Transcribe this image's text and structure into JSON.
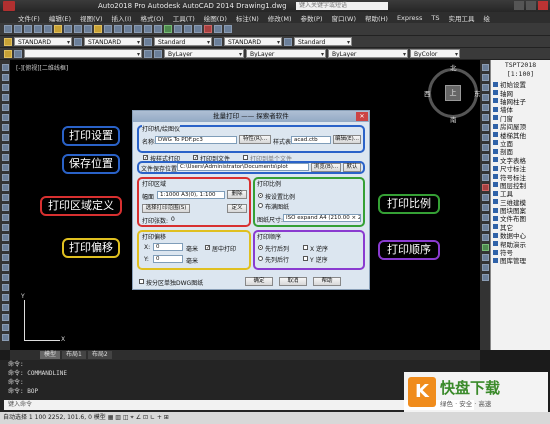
{
  "window": {
    "title": "Auto2018 Pro Autodesk AutoCAD 2014    Drawing1.dwg",
    "search_placeholder": "键入关键字或短语"
  },
  "menu": [
    "文件(F)",
    "编辑(E)",
    "视图(V)",
    "插入(I)",
    "格式(O)",
    "工具(T)",
    "绘图(D)",
    "标注(N)",
    "修改(M)",
    "参数(P)",
    "窗口(W)",
    "帮助(H)",
    "Express",
    "TS",
    "实用工具",
    "绘"
  ],
  "toolbar": {
    "text_style": "STANDARD",
    "dim_style": "STANDARD",
    "style_a": "Standard",
    "style_b": "STANDARD",
    "style_c": "Standard",
    "layer": "ByLayer",
    "linetype": "ByLayer",
    "lineweight": "ByLayer",
    "plot_style": "ByColor"
  },
  "viewport_label": "[-][俯视][二维线框]",
  "viewcube": {
    "north": "北",
    "south": "南",
    "east": "东",
    "west": "西",
    "top": "上"
  },
  "ucs": {
    "x": "X",
    "y": "Y"
  },
  "palette": {
    "header_1": "TSPT2018",
    "header_2": "[1:100]",
    "items": [
      "初始设置",
      "轴网",
      "轴网柱子",
      "墙体",
      "门窗",
      "房间屋顶",
      "楼梯其他",
      "立面",
      "剖面",
      "文字表格",
      "尺寸标注",
      "符号标注",
      "图层控制",
      "工具",
      "三维建模",
      "图块图案",
      "文件布图",
      "其它",
      "数据中心",
      "帮助演示",
      "符号",
      "图库管理"
    ]
  },
  "tabs": [
    "模型",
    "布局1",
    "布局2"
  ],
  "command": {
    "lines": [
      "命令:",
      "命令: COMMANDLINE",
      "命令:",
      "命令: BOP"
    ],
    "input_placeholder": "键入命令"
  },
  "status_text": "自动选择 1 100    2252, 101.6, 0    模型  ▦  ▥  ◫  ⌖  ∠  ⊡  ∟  +  ⊞",
  "dialog": {
    "title": "批量打印 —— 探索者软件",
    "close": "✕",
    "printer_group": "打印机/绘图仪",
    "printer_label": "名称:",
    "printer_value": "DWG To PDF.pc3",
    "properties_btn": "特性(R)...",
    "plot_style_label": "样式表:",
    "plot_style_value": "acad.ctb",
    "edit_btn": "编辑(E)...",
    "cb_fit": "按样式打印",
    "cb_file": "打印到文件",
    "cb_merge": "打印到单个文件",
    "save_label": "文件保存位置:",
    "save_path": "C:\\Users\\Administrator\\Documents\\plot",
    "browse_btn": "浏览(B)...",
    "default_btn": "默认",
    "area_group": "打印区域",
    "area_paper_label": "幅面",
    "area_paper_value": "1:1000 A3(0), 1:100",
    "area_delete_btn": "删除",
    "area_select_btn": "选择打印范围(S)",
    "area_define_btn": "定义",
    "area_count_label": "打印张数:",
    "area_count_value": "0",
    "scale_group": "打印比例",
    "scale_fit": "按设置比例",
    "scale_layout": "布满图纸",
    "scale_paper_label": "图纸尺寸:",
    "scale_paper_value": "ISO expand A4 (210.00 × 297.00 毫米)",
    "offset_group": "打印偏移",
    "offset_x_label": "X:",
    "offset_x_value": "0",
    "offset_y_label": "Y:",
    "offset_y_value": "0",
    "offset_unit": "毫米",
    "offset_center": "居中打印",
    "order_group": "打印顺序",
    "order_row": "先行后列",
    "order_col": "先列后行",
    "order_x_rev": "X 逆序",
    "order_y_rev": "Y 逆序",
    "cb_dwg": "按分区单独DWG图纸",
    "ok_btn": "确定",
    "cancel_btn": "取消",
    "help_btn": "帮助"
  },
  "callouts": {
    "print_settings": "打印设置",
    "save_location": "保存位置",
    "area_define": "打印区域定义",
    "print_offset": "打印偏移",
    "print_scale": "打印比例",
    "print_order": "打印顺序"
  },
  "watermark": {
    "logo": "K",
    "name": "快盘下载",
    "slogan": "绿色 · 安全 · 高速"
  },
  "colors": {
    "blue": "#2a62c8",
    "red": "#d83030",
    "green": "#35a035",
    "purple": "#8a3bd0",
    "yellow": "#e0c020"
  }
}
